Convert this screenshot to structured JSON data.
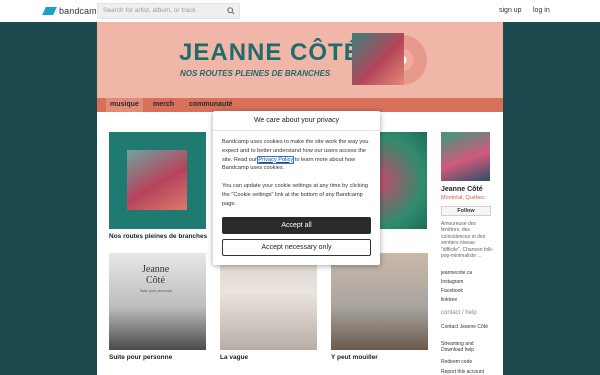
{
  "header": {
    "logo_label": "bandcamp",
    "search_placeholder": "Search for artist, album, or track",
    "signup_label": "sign up",
    "login_label": "log in"
  },
  "banner": {
    "title": "JEANNE CÔTÉ",
    "subtitle": "NOS ROUTES PLEINES DE BRANCHES"
  },
  "tabs": [
    {
      "label": "musique"
    },
    {
      "label": "merch"
    },
    {
      "label": "communauté"
    }
  ],
  "albums": [
    {
      "title": "Nos routes pleines de branches"
    },
    {
      "title": "Suite pour personne",
      "art_text_1": "Jeanne",
      "art_text_2": "Côté",
      "art_text_3": "Suite pour personne"
    },
    {
      "title": "La vague"
    },
    {
      "title": "Y peut mouiller"
    }
  ],
  "artist": {
    "name": "Jeanne Côté",
    "location": "Montréal, Québec",
    "follow_label": "Follow",
    "bio": "Amoureuse des fenêtres, des coïncidences et des sentiers niveau \"difficile\". Chanson folk-pop-minimaliste",
    "more_label": "...",
    "links": [
      "jeannecote.ca",
      "Instagram",
      "Facebook",
      "linktree"
    ],
    "contact_heading": "contact / help",
    "contact_items": [
      "Contact Jeanne Côté",
      "Streaming and Download help",
      "Redeem code",
      "Report this account"
    ]
  },
  "cookie_dialog": {
    "title": "We care about your privacy",
    "text_1_before": "Bandcamp uses cookies to make the site work the way you expect and to better understand how our users access the site. Read our ",
    "privacy_link": "Privacy Policy",
    "text_1_after": " to learn more about how Bandcamp uses cookies.",
    "text_2": "You can update your cookie settings at any time by clicking the \"Cookie settings\" link at the bottom of any Bandcamp page.",
    "accept_all_label": "Accept all",
    "accept_necessary_label": "Accept necessary only"
  },
  "colors": {
    "page_background": "#1c4a4e",
    "banner": "#f0b6a7",
    "tab_bar": "#d9705a",
    "brand": "#1da0c3",
    "title_text": "#1f6c6a"
  }
}
